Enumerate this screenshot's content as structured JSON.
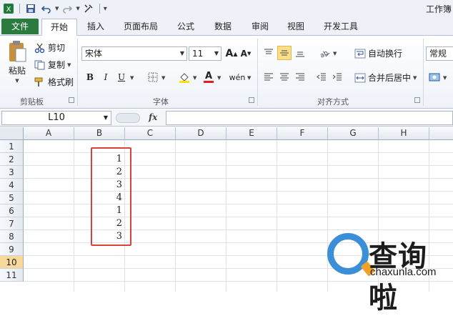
{
  "app": {
    "title": "工作簿"
  },
  "tabs": [
    "文件",
    "开始",
    "插入",
    "页面布局",
    "公式",
    "数据",
    "审阅",
    "视图",
    "开发工具"
  ],
  "ribbon": {
    "clipboard": {
      "paste": "粘贴",
      "cut": "剪切",
      "copy": "复制",
      "format_painter": "格式刷",
      "label": "剪贴板"
    },
    "font": {
      "name": "宋体",
      "size": "11",
      "label": "字体"
    },
    "alignment": {
      "wrap": "自动换行",
      "merge": "合并后居中",
      "label": "对齐方式"
    },
    "number": {
      "format": "常规"
    }
  },
  "formula_bar": {
    "name_box": "L10",
    "fx": "fx",
    "formula": ""
  },
  "grid": {
    "columns": [
      "A",
      "B",
      "C",
      "D",
      "E",
      "F",
      "G",
      "H"
    ],
    "rows": [
      "1",
      "2",
      "3",
      "4",
      "5",
      "6",
      "7",
      "8",
      "9",
      "10",
      "11"
    ],
    "selected_row": "10",
    "b_values": [
      "",
      "1",
      "2",
      "3",
      "4",
      "1",
      "2",
      "3"
    ]
  },
  "watermark": {
    "name": "查询啦",
    "url": "chaxunla.com"
  },
  "colors": {
    "file_tab": "#2b7a3e",
    "highlight": "#d9413b",
    "selected_header": "#f9d99a"
  }
}
